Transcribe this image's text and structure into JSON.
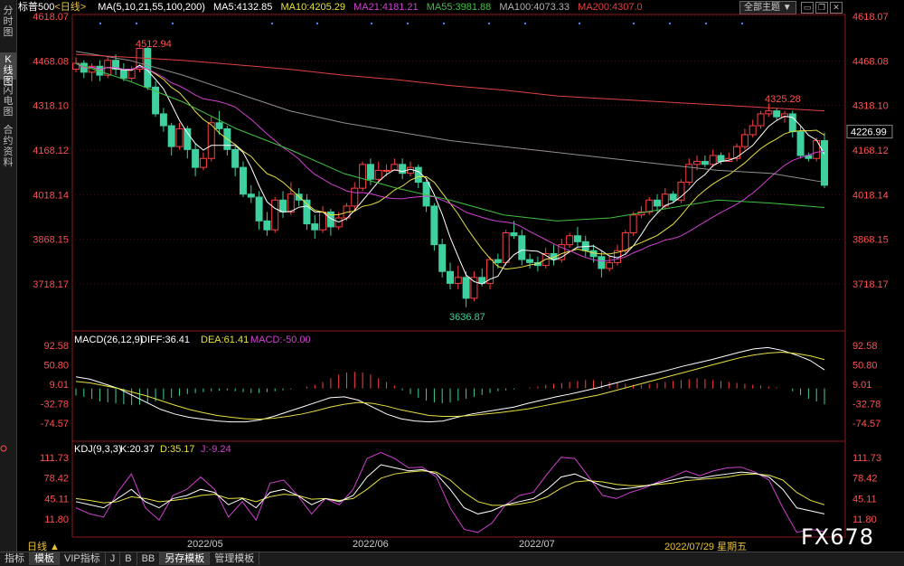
{
  "header": {
    "symbol": "标普500",
    "period_tag": "<日线>",
    "ma_title": "MA(5,10,21,55,100,200)",
    "ma5": "MA5:4132.85",
    "ma10": "MA10:4205.29",
    "ma21": "MA21:4181.21",
    "ma55": "MA55:3981.88",
    "ma100": "MA100:4073.33",
    "ma200": "MA200:4307.0",
    "theme_button": "全部主题"
  },
  "sidebar": {
    "tabs": [
      {
        "label": "分时图"
      },
      {
        "label": "K线图"
      },
      {
        "label": "闪电图"
      },
      {
        "label": "合约资料"
      }
    ]
  },
  "price_axis": [
    "4618.07",
    "4468.08",
    "4318.10",
    "4168.12",
    "4018.14",
    "3868.15",
    "3718.17"
  ],
  "last_price": "4226.99",
  "annotations": {
    "high": "4512.94",
    "mid_high": "4325.28",
    "low": "3636.87"
  },
  "macd": {
    "title": "MACD(26,12,9)",
    "diff": "DIFF:36.41",
    "dea": "DEA:61.41",
    "macd": "MACD:-50.00",
    "axis": [
      "92.58",
      "50.80",
      "9.01",
      "-32.78",
      "-74.57"
    ]
  },
  "kdj": {
    "title": "KDJ(9,3,3)",
    "k": "K:20.37",
    "d": "D:35.17",
    "j": "J:-9.24",
    "axis": [
      "111.73",
      "78.42",
      "45.11",
      "11.80"
    ]
  },
  "x_labels": [
    "2022/05",
    "2022/06",
    "2022/07"
  ],
  "cursor_date": "2022/07/29 星期五",
  "period_label": "日线 ▲",
  "bottom_tabs": [
    "指标",
    "模板",
    "VIP指标",
    "J",
    "B",
    "BB",
    "另存模板",
    "管理模板"
  ],
  "watermark": "FX678",
  "colors": {
    "up": "#ff4040",
    "down": "#3fd0a0",
    "ma5": "#ffffff",
    "ma10": "#e6e040",
    "ma21": "#d040d0",
    "ma55": "#40c040",
    "ma100": "#909090",
    "ma200": "#e04040"
  },
  "chart_data": {
    "type": "candlestick",
    "price_range": [
      3636.87,
      4618.07
    ],
    "candles": [
      [
        4440,
        4460,
        4480,
        4430
      ],
      [
        4460,
        4430,
        4470,
        4410
      ],
      [
        4430,
        4450,
        4460,
        4400
      ],
      [
        4450,
        4420,
        4470,
        4400
      ],
      [
        4420,
        4470,
        4480,
        4410
      ],
      [
        4470,
        4440,
        4490,
        4420
      ],
      [
        4440,
        4410,
        4460,
        4400
      ],
      [
        4410,
        4440,
        4450,
        4400
      ],
      [
        4440,
        4510,
        4513,
        4430
      ],
      [
        4510,
        4380,
        4515,
        4370
      ],
      [
        4380,
        4290,
        4400,
        4280
      ],
      [
        4290,
        4250,
        4310,
        4230
      ],
      [
        4250,
        4180,
        4260,
        4150
      ],
      [
        4180,
        4240,
        4260,
        4170
      ],
      [
        4240,
        4170,
        4250,
        4140
      ],
      [
        4170,
        4110,
        4190,
        4080
      ],
      [
        4110,
        4140,
        4160,
        4100
      ],
      [
        4140,
        4260,
        4280,
        4130
      ],
      [
        4260,
        4240,
        4300,
        4220
      ],
      [
        4240,
        4170,
        4250,
        4150
      ],
      [
        4170,
        4110,
        4180,
        4080
      ],
      [
        4110,
        4020,
        4130,
        4010
      ],
      [
        4020,
        4010,
        4050,
        3990
      ],
      [
        4010,
        3930,
        4030,
        3900
      ],
      [
        3930,
        3900,
        3960,
        3880
      ],
      [
        3900,
        4000,
        4010,
        3890
      ],
      [
        4000,
        3960,
        4030,
        3940
      ],
      [
        3960,
        4020,
        4060,
        3950
      ],
      [
        4020,
        4000,
        4040,
        3980
      ],
      [
        4000,
        3920,
        4020,
        3900
      ],
      [
        3920,
        3900,
        3950,
        3870
      ],
      [
        3900,
        3960,
        3980,
        3890
      ],
      [
        3960,
        3910,
        3970,
        3880
      ],
      [
        3910,
        3940,
        3960,
        3900
      ],
      [
        3940,
        3980,
        3990,
        3930
      ],
      [
        3980,
        4040,
        4060,
        3960
      ],
      [
        4040,
        4120,
        4130,
        4030
      ],
      [
        4120,
        4070,
        4140,
        4050
      ],
      [
        4070,
        4100,
        4130,
        4060
      ],
      [
        4100,
        4100,
        4120,
        4080
      ],
      [
        4100,
        4120,
        4140,
        4100
      ],
      [
        4120,
        4090,
        4140,
        4070
      ],
      [
        4090,
        4110,
        4130,
        4080
      ],
      [
        4110,
        4060,
        4120,
        4040
      ],
      [
        4060,
        3980,
        4070,
        3960
      ],
      [
        3980,
        3850,
        3990,
        3830
      ],
      [
        3850,
        3760,
        3870,
        3740
      ],
      [
        3760,
        3720,
        3790,
        3700
      ],
      [
        3720,
        3740,
        3780,
        3700
      ],
      [
        3740,
        3670,
        3760,
        3640
      ],
      [
        3670,
        3740,
        3760,
        3660
      ],
      [
        3740,
        3720,
        3770,
        3710
      ],
      [
        3720,
        3800,
        3810,
        3700
      ],
      [
        3800,
        3790,
        3820,
        3770
      ],
      [
        3790,
        3890,
        3900,
        3780
      ],
      [
        3890,
        3880,
        3930,
        3870
      ],
      [
        3880,
        3800,
        3900,
        3780
      ],
      [
        3800,
        3790,
        3820,
        3770
      ],
      [
        3790,
        3780,
        3810,
        3760
      ],
      [
        3780,
        3820,
        3840,
        3770
      ],
      [
        3820,
        3800,
        3850,
        3780
      ],
      [
        3800,
        3850,
        3870,
        3790
      ],
      [
        3850,
        3880,
        3890,
        3840
      ],
      [
        3880,
        3860,
        3910,
        3840
      ],
      [
        3860,
        3830,
        3880,
        3810
      ],
      [
        3830,
        3810,
        3850,
        3790
      ],
      [
        3810,
        3770,
        3830,
        3740
      ],
      [
        3770,
        3790,
        3810,
        3760
      ],
      [
        3790,
        3830,
        3850,
        3780
      ],
      [
        3830,
        3890,
        3900,
        3820
      ],
      [
        3890,
        3950,
        3960,
        3880
      ],
      [
        3950,
        3960,
        3980,
        3940
      ],
      [
        3960,
        4000,
        4010,
        3950
      ],
      [
        4000,
        3980,
        4020,
        3960
      ],
      [
        3980,
        4020,
        4040,
        3970
      ],
      [
        4020,
        4000,
        4030,
        3990
      ],
      [
        4000,
        4060,
        4070,
        3990
      ],
      [
        4060,
        4120,
        4140,
        4050
      ],
      [
        4120,
        4130,
        4150,
        4100
      ],
      [
        4130,
        4120,
        4150,
        4110
      ],
      [
        4120,
        4150,
        4170,
        4110
      ],
      [
        4150,
        4130,
        4160,
        4120
      ],
      [
        4130,
        4140,
        4160,
        4130
      ],
      [
        4140,
        4180,
        4190,
        4130
      ],
      [
        4180,
        4220,
        4240,
        4170
      ],
      [
        4220,
        4250,
        4270,
        4210
      ],
      [
        4250,
        4290,
        4300,
        4240
      ],
      [
        4290,
        4300,
        4325,
        4280
      ],
      [
        4300,
        4280,
        4310,
        4270
      ],
      [
        4280,
        4290,
        4300,
        4260
      ],
      [
        4290,
        4230,
        4300,
        4210
      ],
      [
        4230,
        4150,
        4250,
        4140
      ],
      [
        4150,
        4140,
        4160,
        4130
      ],
      [
        4140,
        4200,
        4210,
        4130
      ],
      [
        4200,
        4050,
        4227,
        4040
      ]
    ]
  }
}
